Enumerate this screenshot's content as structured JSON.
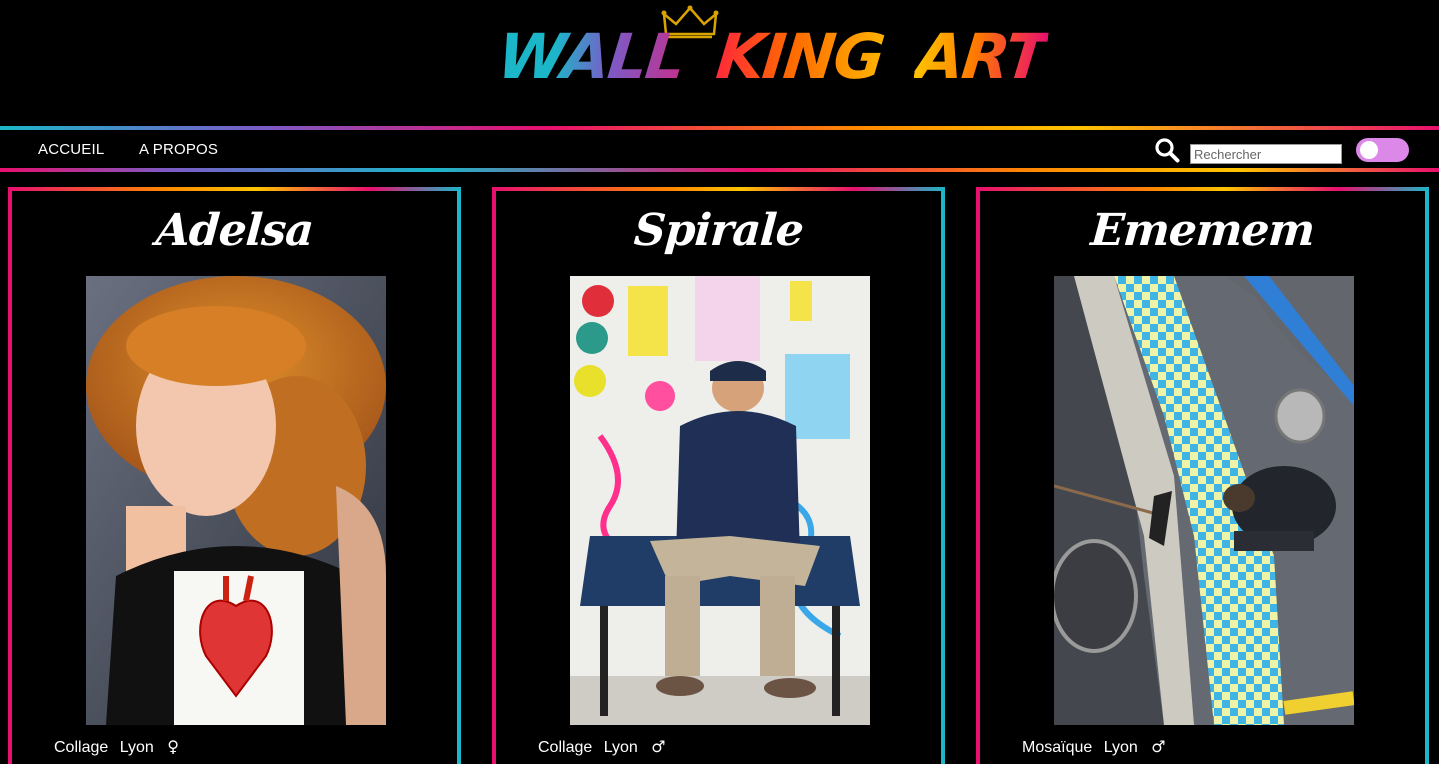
{
  "brand": {
    "logo_text_parts": [
      "WALL",
      "KING",
      "ART"
    ],
    "colors": {
      "cyan": "#1bb7c9",
      "purple": "#7a5cc7",
      "pink": "#e8106e",
      "orange": "#ff8a00",
      "yellow": "#ffc400",
      "toggle": "#dc88e8"
    }
  },
  "nav": {
    "links": [
      {
        "label": "ACCUEIL"
      },
      {
        "label": "A PROPOS"
      }
    ],
    "search": {
      "placeholder": "Rechercher",
      "icon": "search-icon"
    },
    "toggle": {
      "state": "off"
    }
  },
  "artists": [
    {
      "name": "Adelsa",
      "technique": "Collage",
      "city": "Lyon",
      "gender": "♀"
    },
    {
      "name": "Spirale",
      "technique": "Collage",
      "city": "Lyon",
      "gender": "♂"
    },
    {
      "name": "Ememem",
      "technique": "Mosaïque",
      "city": "Lyon",
      "gender": "♂"
    }
  ]
}
